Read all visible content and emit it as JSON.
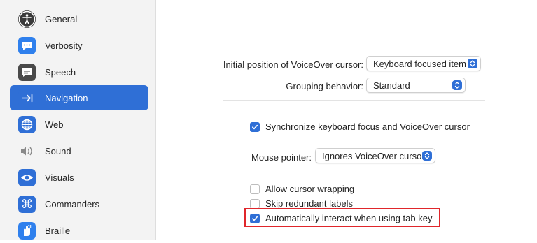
{
  "sidebar": {
    "items": [
      {
        "label": "General",
        "icon": "accessibility-icon",
        "color": "#444444"
      },
      {
        "label": "Verbosity",
        "icon": "speech-bubble-icon",
        "color": "#2f80ed"
      },
      {
        "label": "Speech",
        "icon": "speech-bubble-dark-icon",
        "color": "#555555"
      },
      {
        "label": "Navigation",
        "icon": "arrow-to-bar-icon",
        "color": "#2f6fd6",
        "selected": true
      },
      {
        "label": "Web",
        "icon": "globe-icon",
        "color": "#2f6fd6"
      },
      {
        "label": "Sound",
        "icon": "speaker-icon",
        "color": "#888888"
      },
      {
        "label": "Visuals",
        "icon": "eye-icon",
        "color": "#2f6fd6"
      },
      {
        "label": "Commanders",
        "icon": "command-icon",
        "color": "#2f6fd6"
      },
      {
        "label": "Braille",
        "icon": "braille-hand-icon",
        "color": "#2f80ed"
      }
    ]
  },
  "main": {
    "initial_position": {
      "label": "Initial position of VoiceOver cursor:",
      "value": "Keyboard focused item"
    },
    "grouping": {
      "label": "Grouping behavior:",
      "value": "Standard"
    },
    "sync_focus": {
      "label": "Synchronize keyboard focus and VoiceOver cursor",
      "checked": true
    },
    "mouse_pointer": {
      "label": "Mouse pointer:",
      "value": "Ignores VoiceOver cursor"
    },
    "allow_wrapping": {
      "label": "Allow cursor wrapping",
      "checked": false
    },
    "skip_redundant": {
      "label": "Skip redundant labels",
      "checked": false
    },
    "auto_interact": {
      "label": "Automatically interact when using tab key",
      "checked": true
    }
  },
  "colors": {
    "accent": "#2f6fd6",
    "highlight": "#e0262b"
  }
}
